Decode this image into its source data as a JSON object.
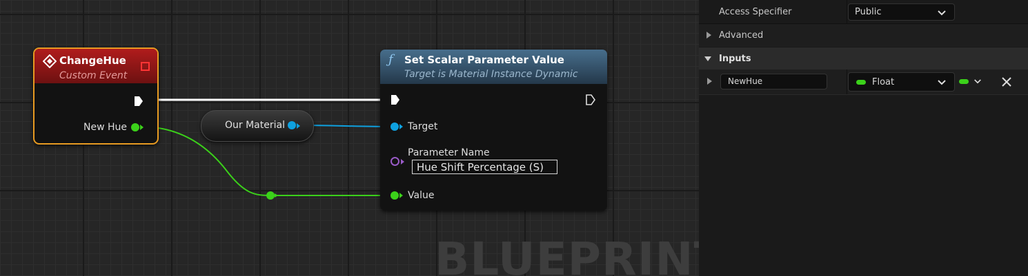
{
  "graph": {
    "watermark": "BLUEPRINT",
    "event_node": {
      "title": "ChangeHue",
      "subtitle": "Custom Event",
      "output_pin": "New Hue"
    },
    "variable_node": {
      "label": "Our Material"
    },
    "function_node": {
      "title": "Set Scalar Parameter Value",
      "subtitle": "Target is Material Instance Dynamic",
      "pin_target": "Target",
      "pin_param_name": "Parameter Name",
      "param_name_value": "Hue Shift Percentage (S)",
      "pin_value": "Value"
    },
    "colors": {
      "exec": "#ffffff",
      "float": "#3bd11a",
      "object": "#0ea1e0",
      "name": "#9a5bc8",
      "event_header": "#b01c1c",
      "function_header": "#476e8c",
      "selection": "#e89b22"
    }
  },
  "details": {
    "access_specifier_label": "Access Specifier",
    "access_specifier_value": "Public",
    "advanced_label": "Advanced",
    "inputs_label": "Inputs",
    "input_name": "NewHue",
    "input_type": "Float"
  }
}
